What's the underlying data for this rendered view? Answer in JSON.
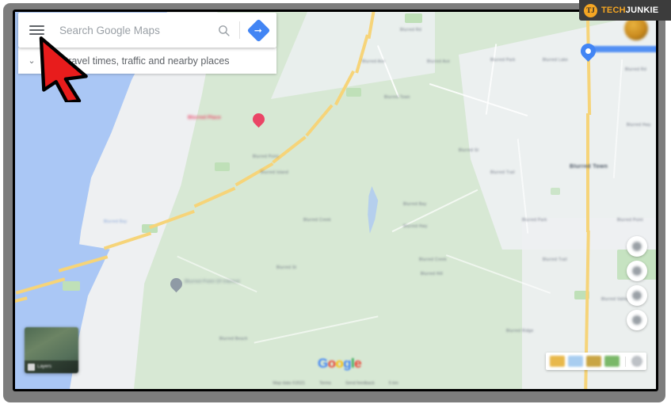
{
  "app": {
    "name": "Google Maps",
    "watermark": {
      "badge": "TJ",
      "text_primary": "TECH",
      "text_secondary": "JUNKIE"
    }
  },
  "search": {
    "placeholder": "Search Google Maps",
    "value": "",
    "menu_icon": "hamburger-menu-icon",
    "search_icon": "search-icon",
    "directions_icon": "directions-icon"
  },
  "travel_panel": {
    "chevron": "⌄",
    "label": "See travel times, traffic and nearby places"
  },
  "annotation": {
    "arrow": "red-arrow-pointing-to-menu",
    "color": "#e81c1c"
  },
  "map": {
    "water_color": "#aac7f5",
    "land_color": "#d7e8d4",
    "urban_color": "#eef0f2",
    "park_color": "#bfe0b8",
    "road_color": "#f6d479",
    "markers": [
      {
        "name": "selected-place-pin",
        "label": "Blurred Place",
        "color": "#ea4566"
      },
      {
        "name": "poi-pin",
        "label": "Blurred Point Of Interest",
        "color": "#8f9aa5"
      }
    ],
    "labels": [
      "Blurred Rd",
      "Blurred Ave",
      "Blurred Park",
      "Blurred Lake",
      "Blurred Town",
      "Blurred St",
      "Blurred Trail",
      "Blurred Bay",
      "Blurred Hwy",
      "Blurred Creek",
      "Blurred Hill",
      "Blurred Point",
      "Blurred Island",
      "Blurred Beach",
      "Blurred Ridge",
      "Blurred Valley"
    ]
  },
  "controls": {
    "stack": [
      {
        "name": "street-view-pegman-button",
        "icon": "pegman-icon"
      },
      {
        "name": "my-location-button",
        "icon": "my-location-icon"
      },
      {
        "name": "zoom-in-button",
        "icon": "plus-icon"
      },
      {
        "name": "zoom-out-button",
        "icon": "minus-icon"
      }
    ],
    "bottom_pill_chips": [
      "#e8b84b",
      "#a8cdf0",
      "#c9a544",
      "#7ab868"
    ],
    "bottom_pill_round": "#bdc1c6",
    "layers_thumbnail": {
      "name": "layers-thumbnail",
      "caption": "Layers"
    }
  },
  "branding": {
    "google": [
      "G",
      "o",
      "o",
      "g",
      "l",
      "e"
    ]
  },
  "attribution": [
    "Map data ©2021",
    "Terms",
    "Send feedback",
    "5 km"
  ]
}
